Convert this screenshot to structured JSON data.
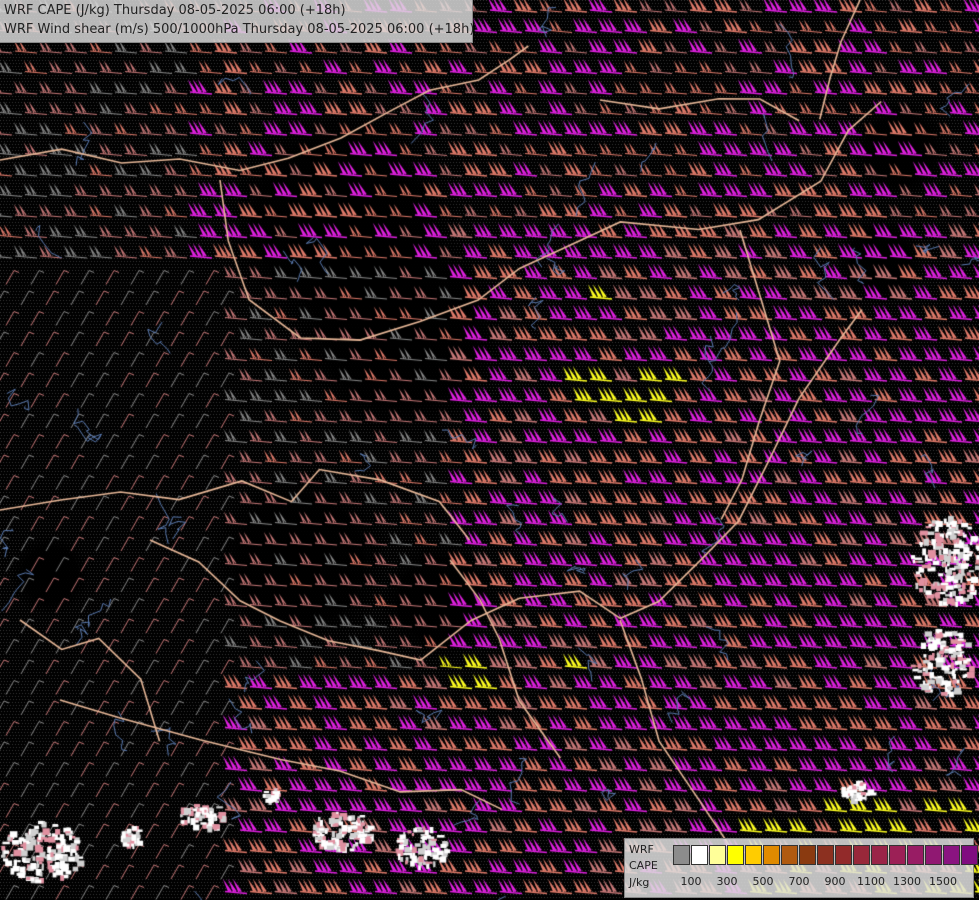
{
  "title": {
    "line1": "WRF CAPE (J/kg) Thursday 08-05-2025 06:00 (+18h)",
    "line2": "WRF Wind shear (m/s) 500/1000hPa Thursday 08-05-2025 06:00 (+18h)"
  },
  "legend": {
    "label_model": "WRF",
    "label_field": "CAPE",
    "label_unit": "J/kg",
    "colors": [
      "#8c8c8c",
      "#ffffff",
      "#ffff99",
      "#ffff00",
      "#ffcc00",
      "#e08a00",
      "#b05a10",
      "#8a3a10",
      "#8c3020",
      "#922a2a",
      "#98283a",
      "#9a2448",
      "#9c2056",
      "#981c64",
      "#901872",
      "#8a1480",
      "#800c80",
      "#7a0a7a"
    ],
    "ticks": [
      "100",
      "300",
      "500",
      "700",
      "900",
      "1100",
      "1300",
      "1500"
    ]
  },
  "map": {
    "background": "#000000",
    "stipple_color": "#3a3a3a",
    "barb_colors": {
      "low": "#8a8a8a",
      "mid": "#c87878",
      "high": "#e07a6a",
      "strong": "#e020e0",
      "cape": "#ffff20"
    },
    "border_color": "#e8b898",
    "river_color": "#5a7ab0"
  }
}
